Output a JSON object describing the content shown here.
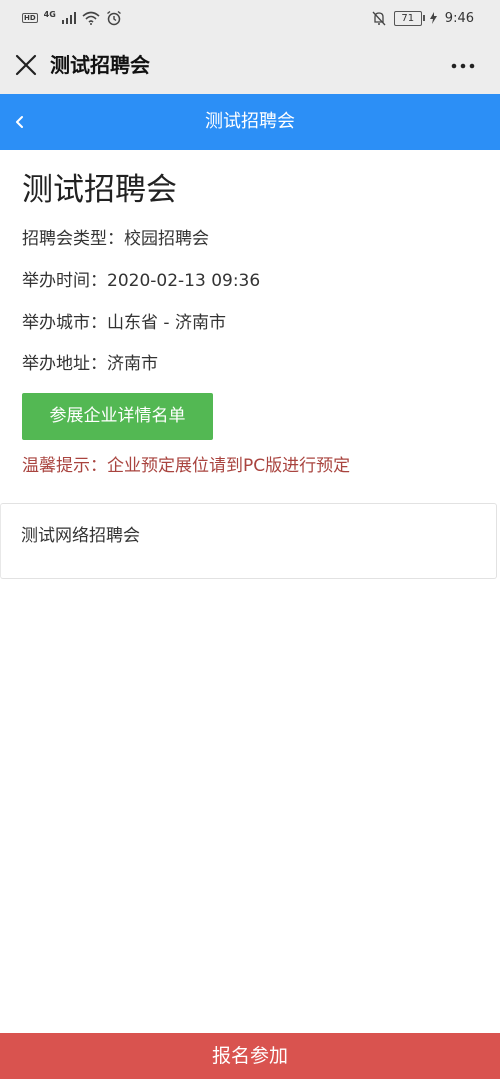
{
  "status_bar": {
    "hd_badge": "HD",
    "network": "4G",
    "battery": "71",
    "time": "9:46",
    "icons": [
      "signal-icon",
      "wifi-icon",
      "alarm-icon",
      "mute-bell-icon",
      "charging-icon"
    ]
  },
  "wechat_bar": {
    "title": "测试招聘会",
    "close_icon": "close-icon",
    "more_icon": "more-icon"
  },
  "header": {
    "title": "测试招聘会",
    "back_icon": "chevron-left-icon",
    "color": "#2c8ff6"
  },
  "fair": {
    "title": "测试招聘会",
    "type_line": "招聘会类型：校园招聘会",
    "time_line": "举办时间：2020-02-13 09:36",
    "city_line": "举办城市：山东省 - 济南市",
    "address_line": "举办地址：济南市",
    "companies_button": "参展企业详情名单",
    "tip": "温馨提示：企业预定展位请到PC版进行预定"
  },
  "card": {
    "text": "测试网络招聘会"
  },
  "bottom": {
    "register_label": "报名参加",
    "color": "#d9534f"
  },
  "colors": {
    "green_button": "#53b853",
    "tip_text": "#a9443f"
  }
}
